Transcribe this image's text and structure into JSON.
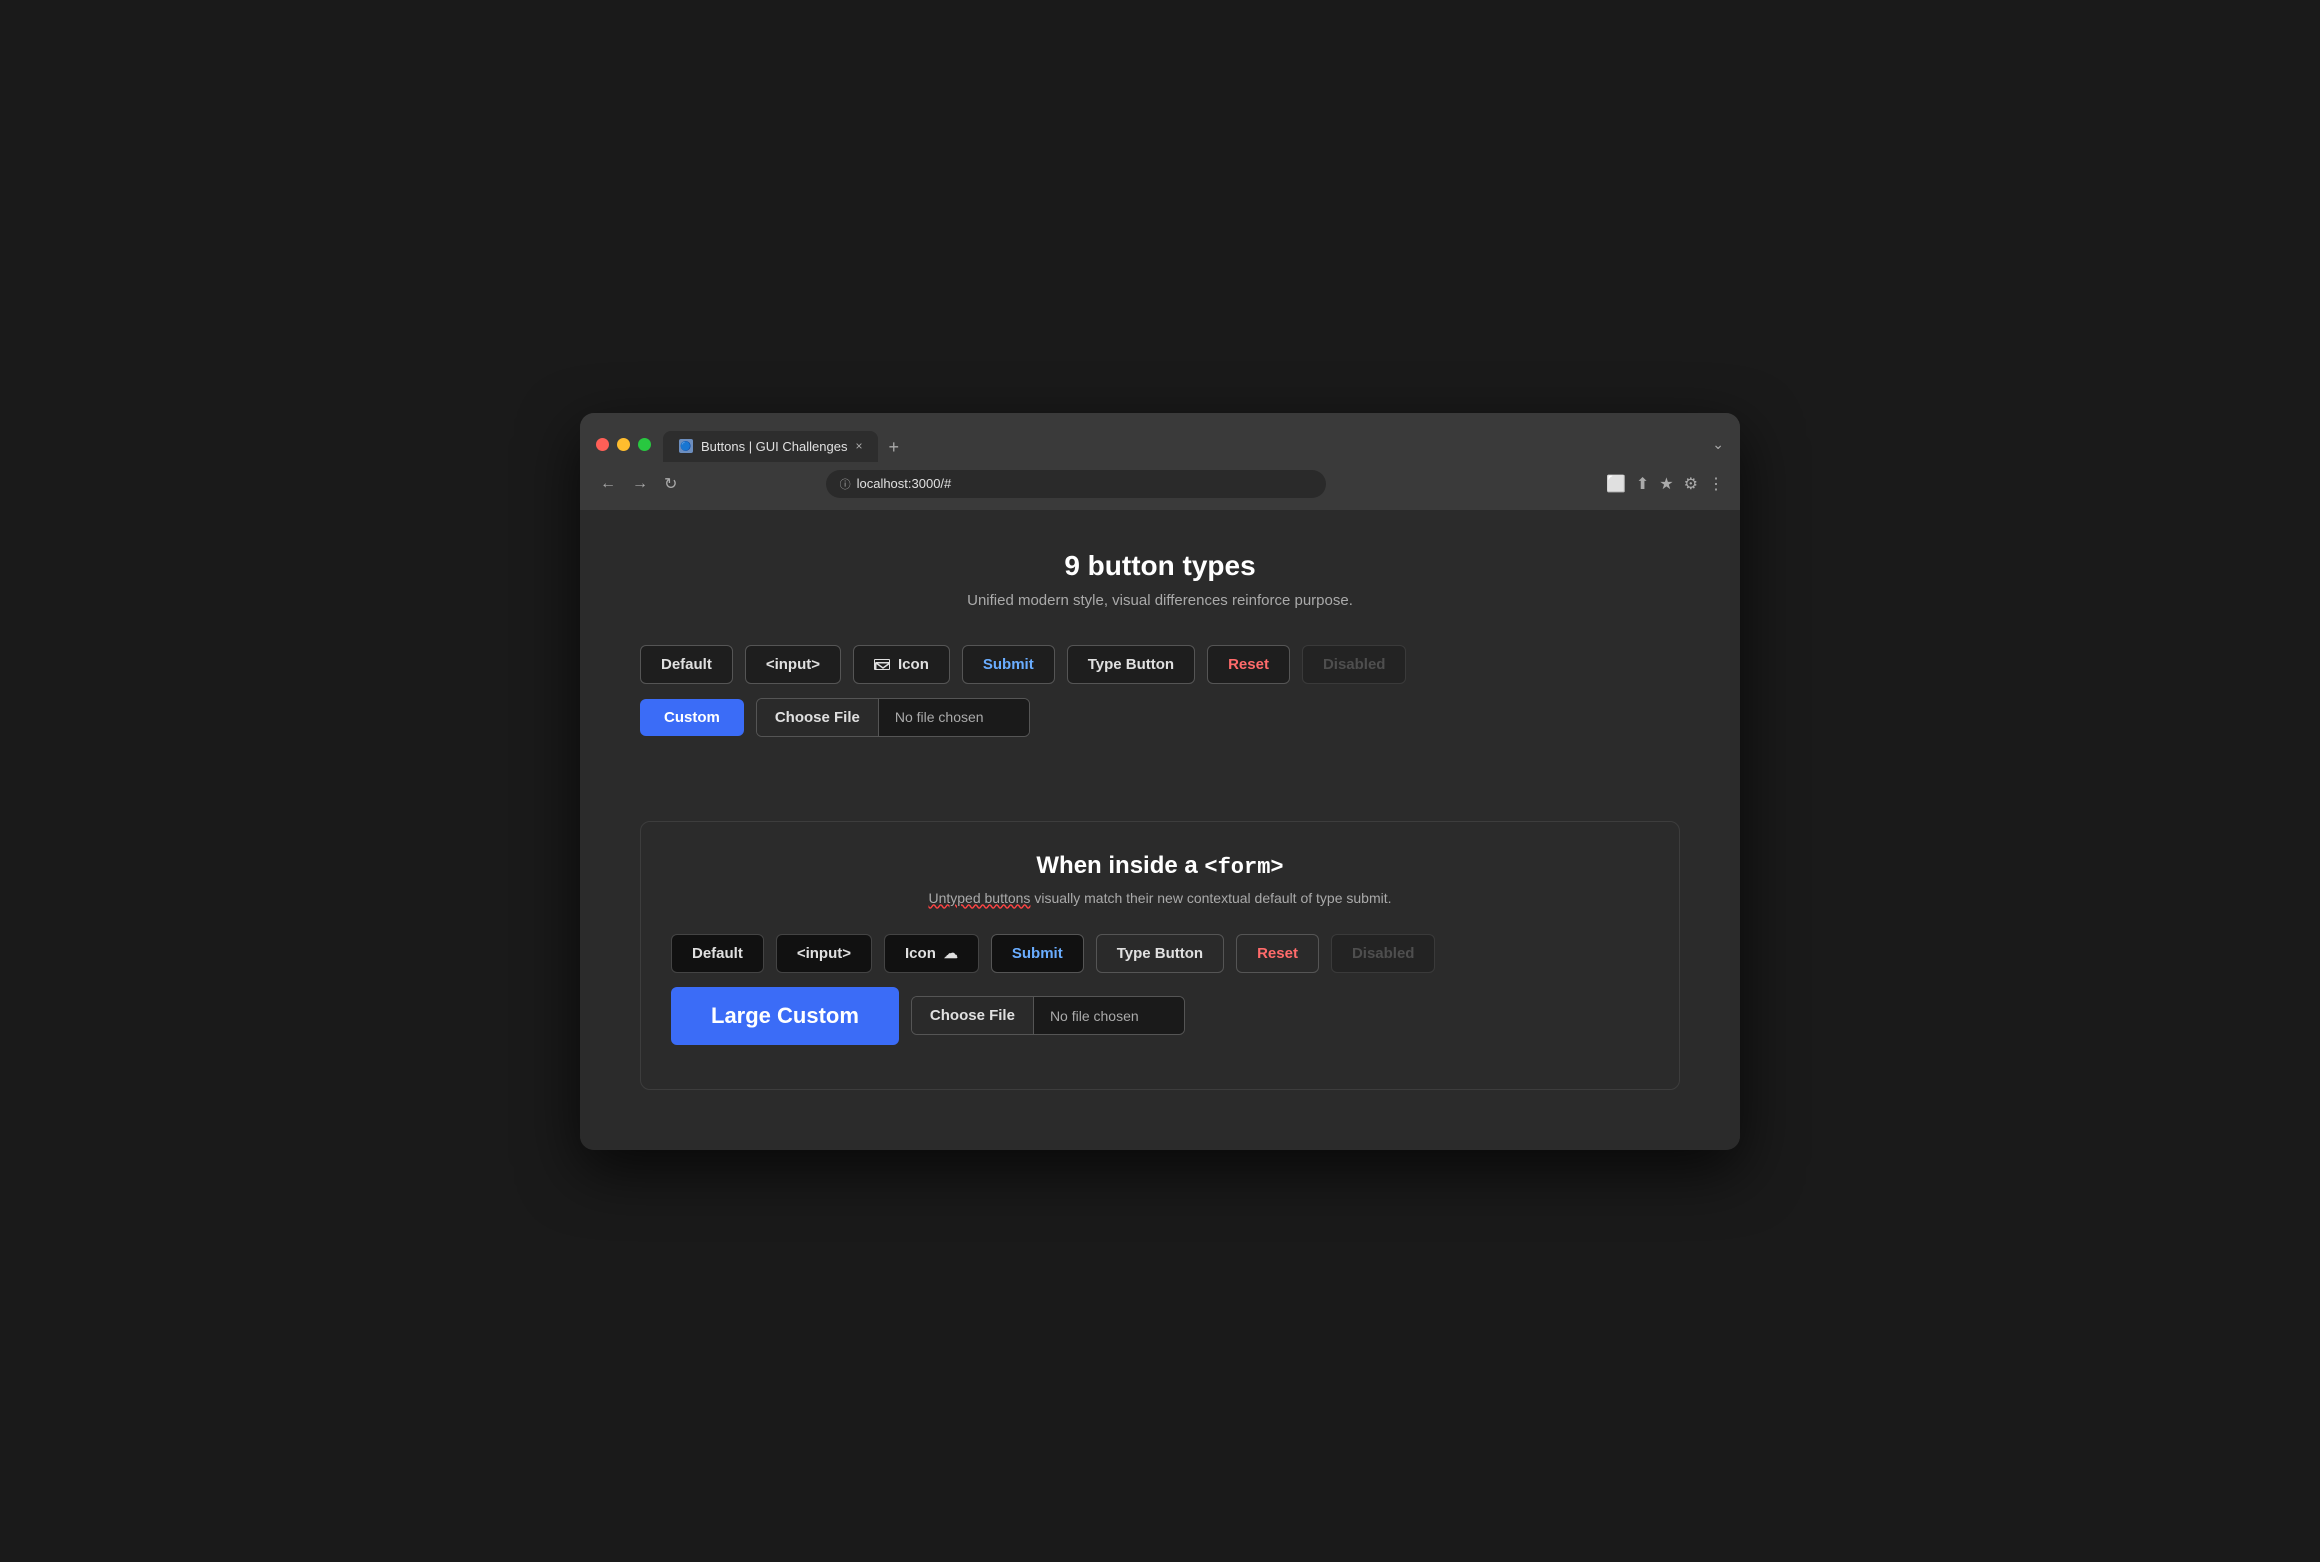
{
  "browser": {
    "tab_title": "Buttons | GUI Challenges",
    "url": "localhost:3000/#",
    "tab_close": "×",
    "tab_new": "+"
  },
  "page": {
    "main_title": "9 button types",
    "main_subtitle": "Unified modern style, visual differences reinforce purpose.",
    "buttons_row1": [
      {
        "label": "Default",
        "type": "default"
      },
      {
        "label": "<input>",
        "type": "default"
      },
      {
        "label": "Icon",
        "type": "icon"
      },
      {
        "label": "Submit",
        "type": "submit"
      },
      {
        "label": "Type Button",
        "type": "default"
      },
      {
        "label": "Reset",
        "type": "reset"
      },
      {
        "label": "Disabled",
        "type": "disabled"
      }
    ],
    "custom_button": "Custom",
    "choose_file_label": "Choose File",
    "no_file_chosen": "No file chosen",
    "form_section": {
      "title": "When inside a ",
      "title_code": "<form>",
      "subtitle_pre": "Untyped buttons",
      "subtitle_post": " visually match their new contextual default of type submit.",
      "buttons_row": [
        {
          "label": "Default",
          "type": "default"
        },
        {
          "label": "<input>",
          "type": "default"
        },
        {
          "label": "Icon",
          "type": "icon"
        },
        {
          "label": "Submit",
          "type": "submit"
        },
        {
          "label": "Type Button",
          "type": "default"
        },
        {
          "label": "Reset",
          "type": "reset"
        },
        {
          "label": "Disabled",
          "type": "disabled"
        }
      ],
      "large_custom_label": "Large Custom",
      "choose_file_label": "Choose File",
      "no_file_chosen": "No file chosen"
    }
  }
}
